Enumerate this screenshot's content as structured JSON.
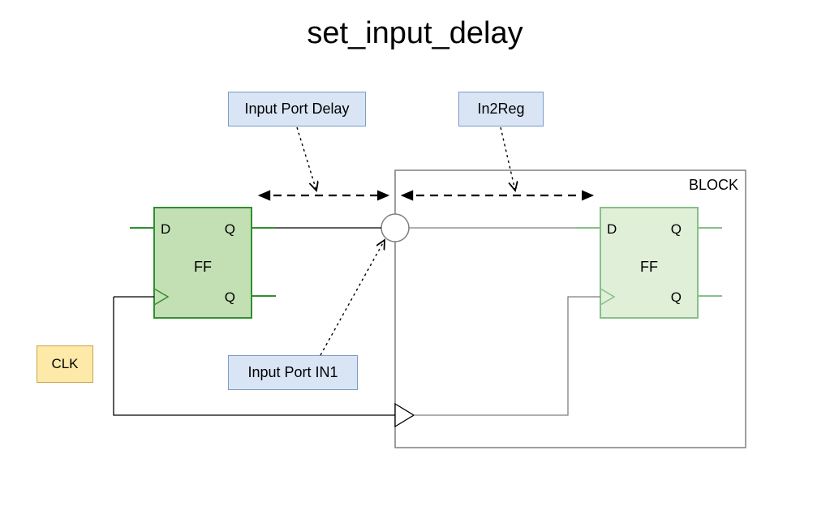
{
  "title": "set_input_delay",
  "labels": {
    "input_port_delay": "Input Port Delay",
    "in2reg": "In2Reg",
    "input_port_in1": "Input Port IN1",
    "clk": "CLK",
    "block": "BLOCK"
  },
  "ff": {
    "name": "FF",
    "d": "D",
    "q": "Q",
    "qbar": "Q"
  },
  "colors": {
    "ff_fill": "#c3e0b4",
    "ff_stroke": "#2f8f2f",
    "ff2_fill": "#e0efd8",
    "ff2_stroke": "#88bf88",
    "block_stroke": "#7f7f7f",
    "label_fill": "#d9e5f5",
    "label_stroke": "#7a9cc6",
    "clk_fill": "#fde9a8",
    "clk_stroke": "#c9a44a"
  }
}
